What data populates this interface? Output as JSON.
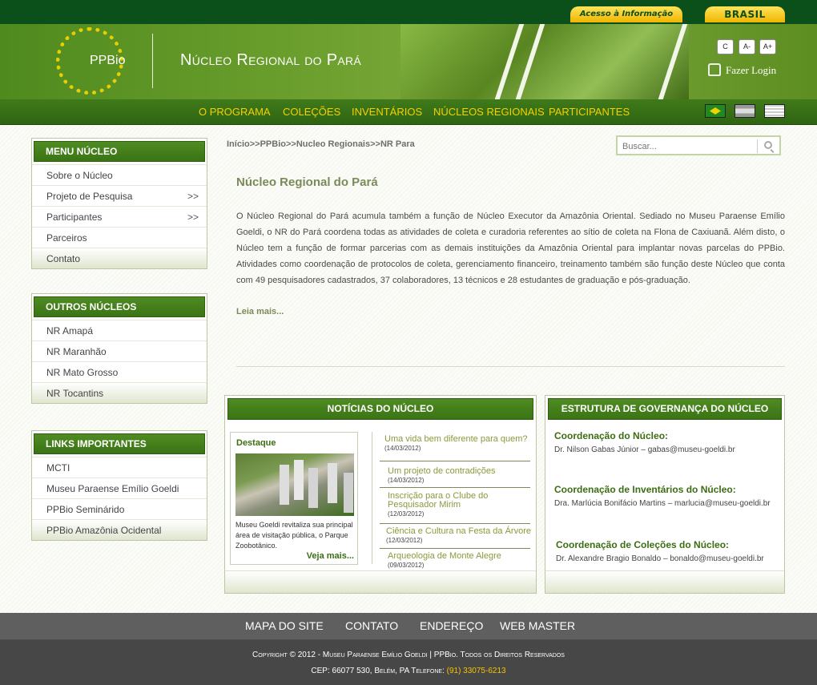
{
  "topbar": {
    "acesso": "Acesso à Informação",
    "brasil": "BRASIL"
  },
  "header": {
    "logo_text": "PPBio",
    "site_title": "Núcleo Regional do Pará",
    "font_buttons": [
      "C",
      "A-",
      "A+"
    ],
    "login": "Fazer Login"
  },
  "nav": {
    "items": [
      "O PROGRAMA",
      "COLEÇÕES",
      "INVENTÁRIOS",
      "NÚCLEOS REGIONAIS",
      "PARTICIPANTES"
    ],
    "flags": [
      "flag-brazil-icon",
      "flag-spain-icon",
      "flag-usa-icon"
    ]
  },
  "sidebar": {
    "menu_nucleo": {
      "title": "MENU NÚCLEO",
      "items": [
        {
          "label": "Sobre o Núcleo",
          "arrow": ""
        },
        {
          "label": "Projeto de Pesquisa",
          "arrow": ">>"
        },
        {
          "label": "Participantes",
          "arrow": ">>"
        },
        {
          "label": "Parceiros",
          "arrow": ""
        },
        {
          "label": "Contato",
          "arrow": ""
        }
      ]
    },
    "outros_nucleos": {
      "title": "OUTROS NÚCLEOS",
      "items": [
        "NR Amapá",
        "NR Maranhão",
        "NR Mato Grosso",
        "NR Tocantins"
      ]
    },
    "links": {
      "title": "LINKS IMPORTANTES",
      "items": [
        "MCTI",
        "Museu Paraense Emílio Goeldi",
        "PPBio Seminárido",
        "PPBio Amazônia Ocidental"
      ]
    }
  },
  "breadcrumb": "Início>>PPBio>>Nucleo Regionais>>NR Para",
  "search": {
    "placeholder": "Buscar..."
  },
  "article": {
    "title": "Núcleo Regional do Pará",
    "body": "O Núcleo Regional do Pará acumula também a função de Núcleo Executor da Amazônia Oriental. Sediado no Museu Paraense Emílio Goeldi, o NR do Pará coordena todas as atividades de coleta e curadoria referentes ao sítio de coleta na Flona de Caxiuanã. Além disto, o Núcleo tem a função de formar parcerias com as demais instituições da Amazônia Oriental para implantar novas parcelas do PPBio. Atividades como coordenação de protocolos de coleta, gerenciamento financeiro, treinamento também são função deste Núcleo que conta com 49 pesquisadores cadastrados, 37 colaboradores, 13 técnicos e 28 estudantes de graduação e pós-graduação.",
    "read_more": "Leia mais..."
  },
  "news": {
    "title": "NOTÍCIAS DO NÚCLEO",
    "destaque": {
      "label": "Destaque",
      "text": "Museu Goeldi revitaliza sua principal área de visitação pública, o Parque Zoobotânico.",
      "more": "Veja mais..."
    },
    "items": [
      {
        "title": "Uma vida bem diferente para quem?",
        "date": "(14/03/2012)"
      },
      {
        "title": "Um projeto de contradições",
        "date": "(14/03/2012)"
      },
      {
        "title": "Inscrição para o Clube do Pesquisador Mirim",
        "date": "(12/03/2012)"
      },
      {
        "title": "Ciência e Cultura na Festa da Árvore",
        "date": "(12/03/2012)"
      },
      {
        "title": "Arqueologia de Monte Alegre",
        "date": "(09/03/2012)"
      }
    ]
  },
  "governance": {
    "title": "ESTRUTURA DE GOVERNANÇA DO NÚCLEO",
    "items": [
      {
        "head": "Coordenação do Núcleo:",
        "text": "Dr. Nilson Gabas Júnior – gabas@museu-goeldi.br"
      },
      {
        "head": "Coordenação de Inventários do Núcleo:",
        "text": "Dra. Marlúcia Bonifácio Martins – marlucia@museu-goeldi.br"
      },
      {
        "head": "Coordenação de Coleções do Núcleo:",
        "text": "Dr. Alexandre Bragio Bonaldo – bonaldo@museu-goeldi.br"
      }
    ]
  },
  "footer": {
    "nav": [
      "MAPA DO SITE",
      "CONTATO",
      "ENDEREÇO",
      "WEB MASTER"
    ],
    "copyright": "Copyright © 2012 - Museu Paraense Emílio Goeldi | PPBio. Todos os Direitos Reservados",
    "address": "CEP: 66077 530, Belém, PA Telefone: ",
    "phone": "(91) 33075-6213"
  }
}
